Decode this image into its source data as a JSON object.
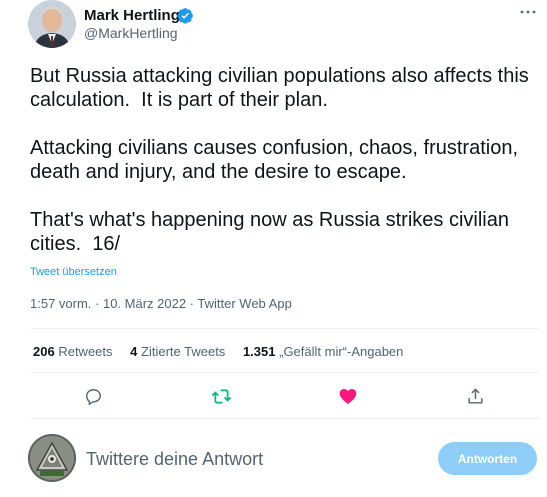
{
  "author": {
    "name": "Mark Hertling",
    "handle": "@MarkHertling"
  },
  "tweet": {
    "text": "But Russia attacking civilian populations also affects this calculation.  It is part of their plan.\n\nAttacking civilians causes confusion, chaos, frustration, death and injury, and the desire to escape.\n\nThat's what's happening now as Russia strikes civilian cities.  16/",
    "translate_link": "Tweet übersetzen",
    "meta": "1:57 vorm. · 10. März 2022 · Twitter Web App"
  },
  "stats": {
    "retweets_count": "206",
    "retweets_label": "Retweets",
    "quotes_count": "4",
    "quotes_label": "Zitierte Tweets",
    "likes_count": "1.351",
    "likes_label": "„Gefällt mir“-Angaben"
  },
  "actions": {
    "reply_icon": "reply-icon",
    "retweet_icon": "retweet-icon",
    "like_icon": "heart-icon",
    "share_icon": "share-icon"
  },
  "reply": {
    "placeholder": "Twittere deine Antwort",
    "button_label": "Antworten"
  },
  "colors": {
    "accent": "#1d9bf0",
    "retweet_green": "#00ba7c",
    "like_pink": "#f91880",
    "button_disabled": "#8ecdf8"
  }
}
